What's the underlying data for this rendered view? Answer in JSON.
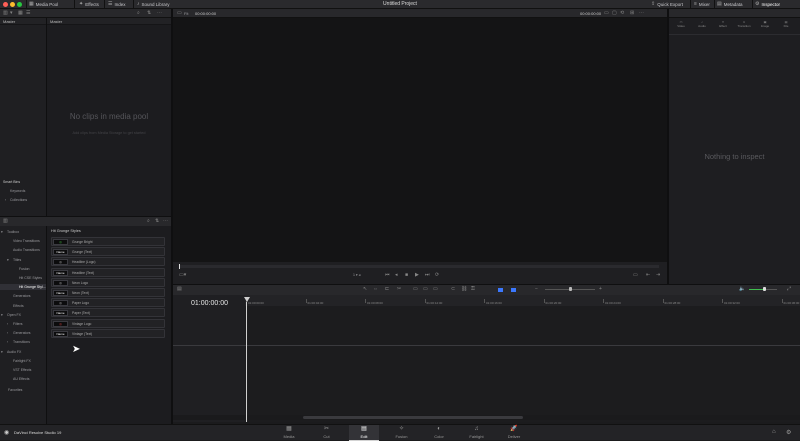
{
  "window": {
    "title": "Untitled Project"
  },
  "topbar": {
    "left": [
      {
        "icon": "media-pool-icon",
        "label": "Media Pool"
      },
      {
        "icon": "effects-icon",
        "label": "Effects"
      },
      {
        "icon": "index-icon",
        "label": "Index"
      },
      {
        "icon": "sound-library-icon",
        "label": "Sound Library"
      }
    ],
    "right": [
      {
        "icon": "quick-export-icon",
        "label": "Quick Export"
      },
      {
        "icon": "mixer-icon",
        "label": "Mixer"
      },
      {
        "icon": "metadata-icon",
        "label": "Metadata"
      },
      {
        "icon": "inspector-icon",
        "label": "Inspector"
      }
    ]
  },
  "media_pool": {
    "bins_header": "Master",
    "clips_header": "Master",
    "empty_title": "No clips in media pool",
    "empty_sub": "Add clips from Media Storage to get started",
    "smart_bins": "Smart Bins",
    "smart_items": [
      "Keywords",
      "Collections"
    ]
  },
  "viewer": {
    "zoom": "Fit",
    "timecode_left": "00:00:00:00",
    "timecode_right": "00:00:00:00",
    "page_counter": "1 ▾ ◂"
  },
  "inspector": {
    "tabs": [
      "Video",
      "Audio",
      "Effect",
      "Transition",
      "Image",
      "File"
    ],
    "empty": "Nothing to inspect"
  },
  "effects": {
    "tree": [
      {
        "label": "Toolbox",
        "level": 0,
        "caret": "▾"
      },
      {
        "label": "Video Transitions",
        "level": 1,
        "caret": ""
      },
      {
        "label": "Audio Transitions",
        "level": 1,
        "caret": ""
      },
      {
        "label": "Titles",
        "level": 1,
        "caret": "▾"
      },
      {
        "label": "Fusion",
        "level": 2,
        "caret": ""
      },
      {
        "label": "Hit CSE Styles",
        "level": 2,
        "caret": ""
      },
      {
        "label": "Hit Grunge Styl...",
        "level": 2,
        "caret": "",
        "selected": true
      },
      {
        "label": "Generators",
        "level": 1,
        "caret": ""
      },
      {
        "label": "Effects",
        "level": 1,
        "caret": ""
      },
      {
        "label": "Open FX",
        "level": 0,
        "caret": "▾"
      },
      {
        "label": "Filters",
        "level": 1,
        "caret": "›"
      },
      {
        "label": "Generators",
        "level": 1,
        "caret": "›"
      },
      {
        "label": "Transitions",
        "level": 1,
        "caret": "›"
      },
      {
        "label": "Audio FX",
        "level": 0,
        "caret": "▾"
      },
      {
        "label": "Fairlight FX",
        "level": 1,
        "caret": ""
      },
      {
        "label": "VST Effects",
        "level": 1,
        "caret": ""
      },
      {
        "label": "AU Effects",
        "level": 1,
        "caret": ""
      }
    ],
    "favorites": "Favorites",
    "list_header": "Hit Grunge Styles",
    "items": [
      {
        "thumb": "◎",
        "name": "Grunge Bright"
      },
      {
        "thumb": "Name",
        "name": "Grunge (Text)"
      },
      {
        "thumb": "◎",
        "name": "Headline (Logo)"
      },
      {
        "thumb": "Name",
        "name": "Headline (Text)"
      },
      {
        "thumb": "◎",
        "name": "Neon Logo"
      },
      {
        "thumb": "Name",
        "name": "Neon (Text)"
      },
      {
        "thumb": "◎",
        "name": "Paper Logo"
      },
      {
        "thumb": "Name",
        "name": "Paper (Text)"
      },
      {
        "thumb": "◎",
        "name": "Vintage Logo"
      },
      {
        "thumb": "Name",
        "name": "Vintage (Text)"
      }
    ]
  },
  "timeline": {
    "timecode": "01:00:00:00",
    "ruler": [
      "01:00:00:00",
      "01:00:04:00",
      "01:00:08:00",
      "01:00:12:00",
      "01:00:16:00",
      "01:00:20:00",
      "01:00:24:00",
      "01:00:28:00",
      "01:00:32:00",
      "01:00:36:00"
    ],
    "volume_level": 0.55
  },
  "app": {
    "name": "DaVinci Resolve Studio 19"
  },
  "pages": [
    {
      "icon": "media-page-icon",
      "glyph": "▦",
      "label": "Media"
    },
    {
      "icon": "cut-page-icon",
      "glyph": "✂",
      "label": "Cut"
    },
    {
      "icon": "edit-page-icon",
      "glyph": "▤",
      "label": "Edit",
      "active": true
    },
    {
      "icon": "fusion-page-icon",
      "glyph": "✧",
      "label": "Fusion"
    },
    {
      "icon": "color-page-icon",
      "glyph": "◐",
      "label": "Color"
    },
    {
      "icon": "fairlight-page-icon",
      "glyph": "♫",
      "label": "Fairlight"
    },
    {
      "icon": "deliver-page-icon",
      "glyph": "🚀",
      "label": "Deliver"
    }
  ],
  "colors": {
    "accent": "#e0e0e0",
    "playhead": "#c9c9c9",
    "volume": "#3fbf4f",
    "flag_blue": "#3b78ff"
  }
}
